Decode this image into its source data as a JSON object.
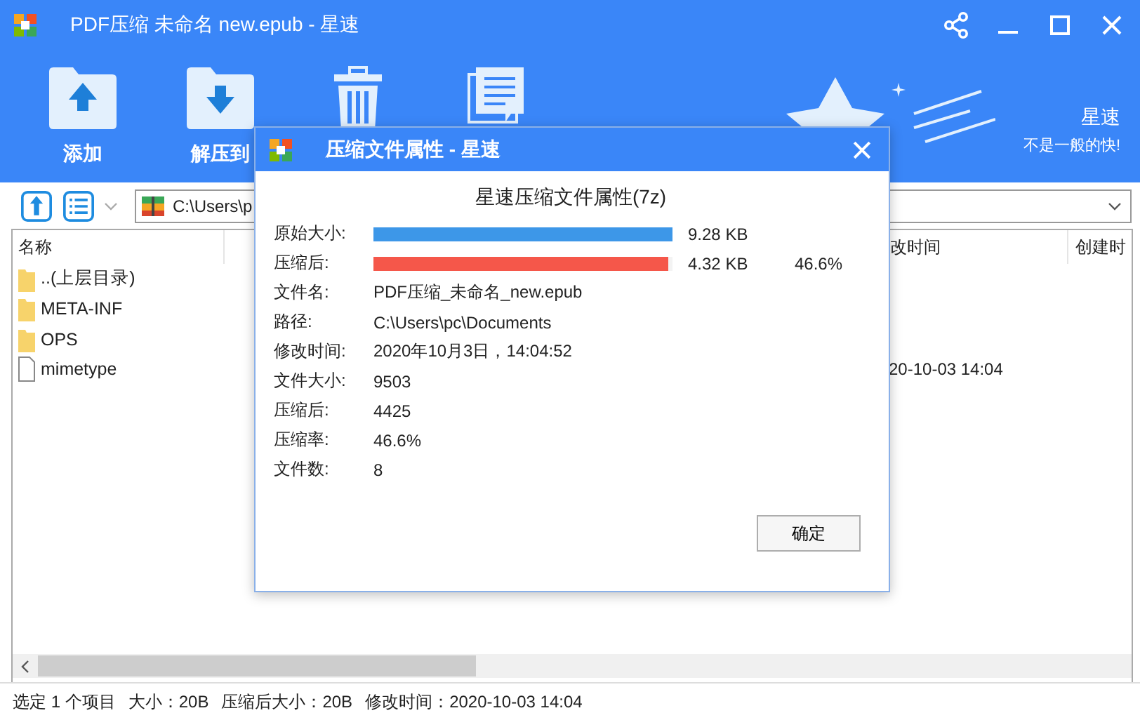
{
  "window": {
    "title": "PDF压缩 未命名 new.epub - 星速"
  },
  "toolbar": {
    "buttons": [
      {
        "label": "添加",
        "kind": "add"
      },
      {
        "label": "解压到",
        "kind": "extract"
      },
      {
        "kind": "delete"
      },
      {
        "kind": "info"
      }
    ],
    "brand": {
      "name": "星速",
      "slogan": "不是一般的快!"
    }
  },
  "path_bar": {
    "path": "C:\\Users\\p"
  },
  "file_list": {
    "columns": [
      {
        "label": "名称"
      },
      {
        "label": "改时间"
      },
      {
        "label": "创建时"
      }
    ],
    "rows": [
      {
        "name": "..(上层目录)",
        "kind": "folder"
      },
      {
        "name": "META-INF",
        "kind": "folder"
      },
      {
        "name": "OPS",
        "kind": "folder"
      },
      {
        "name": "mimetype",
        "kind": "file",
        "modified": "20-10-03 14:04"
      }
    ]
  },
  "status_bar": [
    "选定 1 个项目",
    "大小：20B",
    "压缩后大小：20B",
    "修改时间：2020-10-03 14:04"
  ],
  "dialog": {
    "title": "压缩文件属性 - 星速",
    "heading": "星速压缩文件属性(7z)",
    "rows": [
      {
        "kind": "bar",
        "label": "原始大小:",
        "level": 1,
        "color": "#3d97e8",
        "reading": "9.28 KB"
      },
      {
        "kind": "bar",
        "label": "压缩后:",
        "level": 0.986,
        "color": "#f5574a",
        "reading": "4.32 KB",
        "ratio": "46.6%"
      },
      {
        "kind": "text",
        "label": "文件名:",
        "value": "PDF压缩_未命名_new.epub"
      },
      {
        "kind": "text",
        "label": "路径:",
        "value": "C:\\Users\\pc\\Documents"
      },
      {
        "kind": "text",
        "label": "修改时间:",
        "value": "2020年10月3日，14:04:52"
      },
      {
        "kind": "text",
        "label": "文件大小:",
        "value": "9503"
      },
      {
        "kind": "text",
        "label": "压缩后:",
        "value": "4425"
      },
      {
        "kind": "text",
        "label": "压缩率:",
        "value": "46.6%"
      },
      {
        "kind": "text",
        "label": "文件数:",
        "value": "8"
      }
    ],
    "ok_button": "确定"
  }
}
